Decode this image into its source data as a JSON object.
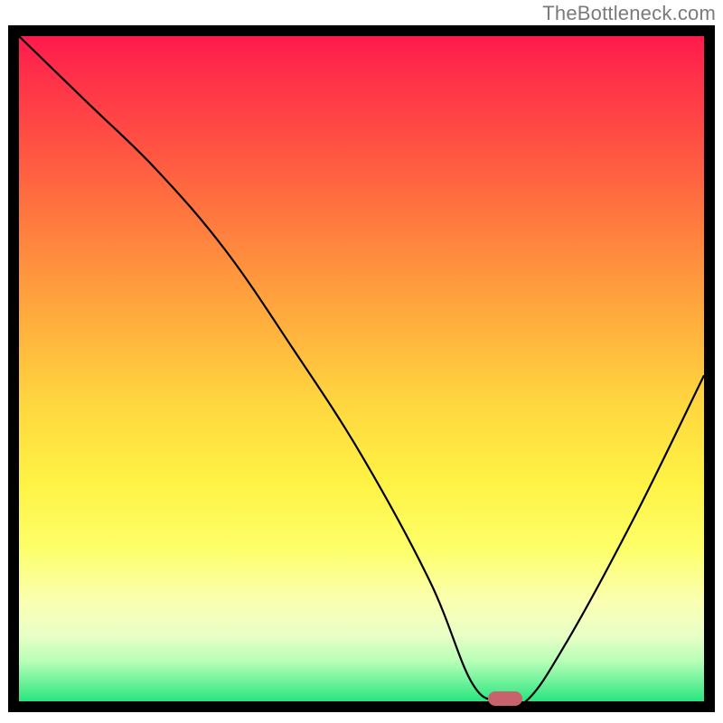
{
  "watermark": "TheBottleneck.com",
  "colors": {
    "frame": "#000000",
    "curve": "#000000",
    "marker": "#c9636b",
    "gradient_top": "#ff1a4d",
    "gradient_mid": "#ffd63f",
    "gradient_low": "#fdff68",
    "gradient_bottom": "#29e57f"
  },
  "chart_data": {
    "type": "line",
    "title": "",
    "xlabel": "",
    "ylabel": "",
    "xlim": [
      0,
      100
    ],
    "ylim": [
      0,
      100
    ],
    "series": [
      {
        "name": "bottleneck-curve",
        "x": [
          0,
          10,
          20,
          30,
          40,
          50,
          60,
          66,
          70,
          74,
          80,
          90,
          100
        ],
        "values": [
          100,
          90,
          80,
          68,
          53,
          37,
          18,
          3,
          0,
          0,
          9,
          28,
          49
        ]
      }
    ],
    "marker": {
      "x": 71,
      "y": 0,
      "label": ""
    }
  }
}
